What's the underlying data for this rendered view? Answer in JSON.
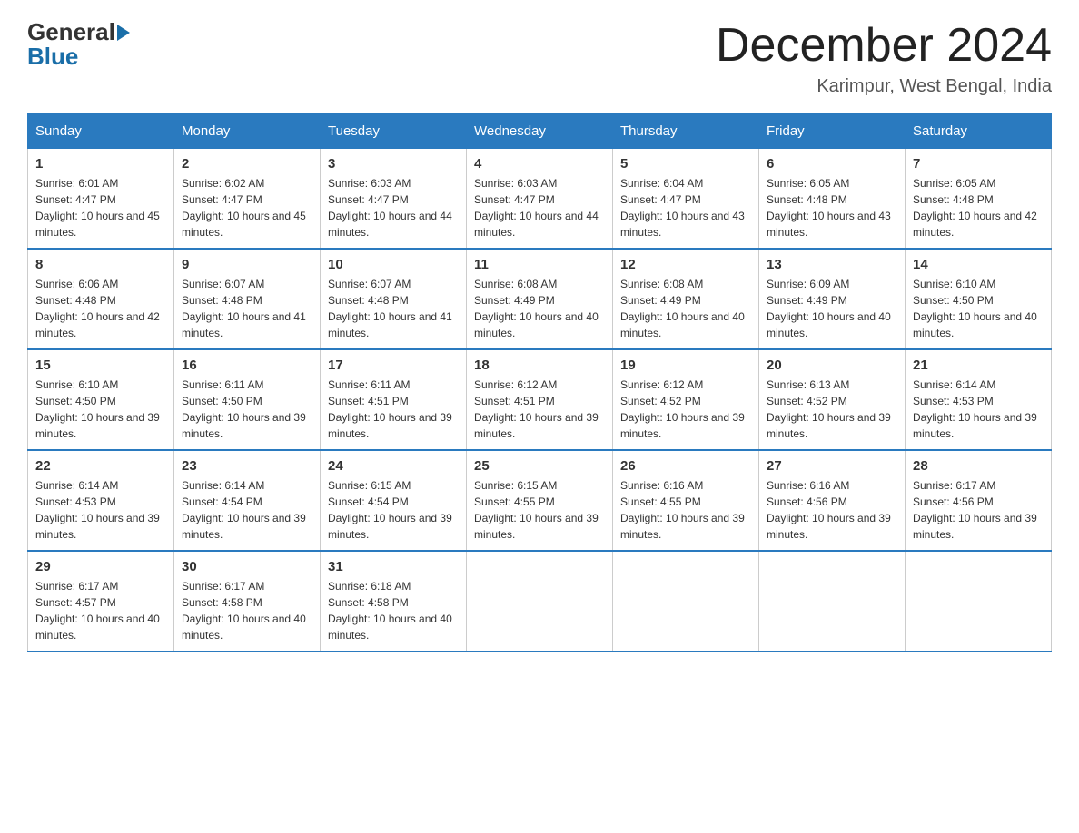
{
  "header": {
    "logo_general": "General",
    "logo_blue": "Blue",
    "month_title": "December 2024",
    "location": "Karimpur, West Bengal, India"
  },
  "weekdays": [
    "Sunday",
    "Monday",
    "Tuesday",
    "Wednesday",
    "Thursday",
    "Friday",
    "Saturday"
  ],
  "weeks": [
    [
      {
        "day": "1",
        "sunrise": "6:01 AM",
        "sunset": "4:47 PM",
        "daylight": "10 hours and 45 minutes."
      },
      {
        "day": "2",
        "sunrise": "6:02 AM",
        "sunset": "4:47 PM",
        "daylight": "10 hours and 45 minutes."
      },
      {
        "day": "3",
        "sunrise": "6:03 AM",
        "sunset": "4:47 PM",
        "daylight": "10 hours and 44 minutes."
      },
      {
        "day": "4",
        "sunrise": "6:03 AM",
        "sunset": "4:47 PM",
        "daylight": "10 hours and 44 minutes."
      },
      {
        "day": "5",
        "sunrise": "6:04 AM",
        "sunset": "4:47 PM",
        "daylight": "10 hours and 43 minutes."
      },
      {
        "day": "6",
        "sunrise": "6:05 AM",
        "sunset": "4:48 PM",
        "daylight": "10 hours and 43 minutes."
      },
      {
        "day": "7",
        "sunrise": "6:05 AM",
        "sunset": "4:48 PM",
        "daylight": "10 hours and 42 minutes."
      }
    ],
    [
      {
        "day": "8",
        "sunrise": "6:06 AM",
        "sunset": "4:48 PM",
        "daylight": "10 hours and 42 minutes."
      },
      {
        "day": "9",
        "sunrise": "6:07 AM",
        "sunset": "4:48 PM",
        "daylight": "10 hours and 41 minutes."
      },
      {
        "day": "10",
        "sunrise": "6:07 AM",
        "sunset": "4:48 PM",
        "daylight": "10 hours and 41 minutes."
      },
      {
        "day": "11",
        "sunrise": "6:08 AM",
        "sunset": "4:49 PM",
        "daylight": "10 hours and 40 minutes."
      },
      {
        "day": "12",
        "sunrise": "6:08 AM",
        "sunset": "4:49 PM",
        "daylight": "10 hours and 40 minutes."
      },
      {
        "day": "13",
        "sunrise": "6:09 AM",
        "sunset": "4:49 PM",
        "daylight": "10 hours and 40 minutes."
      },
      {
        "day": "14",
        "sunrise": "6:10 AM",
        "sunset": "4:50 PM",
        "daylight": "10 hours and 40 minutes."
      }
    ],
    [
      {
        "day": "15",
        "sunrise": "6:10 AM",
        "sunset": "4:50 PM",
        "daylight": "10 hours and 39 minutes."
      },
      {
        "day": "16",
        "sunrise": "6:11 AM",
        "sunset": "4:50 PM",
        "daylight": "10 hours and 39 minutes."
      },
      {
        "day": "17",
        "sunrise": "6:11 AM",
        "sunset": "4:51 PM",
        "daylight": "10 hours and 39 minutes."
      },
      {
        "day": "18",
        "sunrise": "6:12 AM",
        "sunset": "4:51 PM",
        "daylight": "10 hours and 39 minutes."
      },
      {
        "day": "19",
        "sunrise": "6:12 AM",
        "sunset": "4:52 PM",
        "daylight": "10 hours and 39 minutes."
      },
      {
        "day": "20",
        "sunrise": "6:13 AM",
        "sunset": "4:52 PM",
        "daylight": "10 hours and 39 minutes."
      },
      {
        "day": "21",
        "sunrise": "6:14 AM",
        "sunset": "4:53 PM",
        "daylight": "10 hours and 39 minutes."
      }
    ],
    [
      {
        "day": "22",
        "sunrise": "6:14 AM",
        "sunset": "4:53 PM",
        "daylight": "10 hours and 39 minutes."
      },
      {
        "day": "23",
        "sunrise": "6:14 AM",
        "sunset": "4:54 PM",
        "daylight": "10 hours and 39 minutes."
      },
      {
        "day": "24",
        "sunrise": "6:15 AM",
        "sunset": "4:54 PM",
        "daylight": "10 hours and 39 minutes."
      },
      {
        "day": "25",
        "sunrise": "6:15 AM",
        "sunset": "4:55 PM",
        "daylight": "10 hours and 39 minutes."
      },
      {
        "day": "26",
        "sunrise": "6:16 AM",
        "sunset": "4:55 PM",
        "daylight": "10 hours and 39 minutes."
      },
      {
        "day": "27",
        "sunrise": "6:16 AM",
        "sunset": "4:56 PM",
        "daylight": "10 hours and 39 minutes."
      },
      {
        "day": "28",
        "sunrise": "6:17 AM",
        "sunset": "4:56 PM",
        "daylight": "10 hours and 39 minutes."
      }
    ],
    [
      {
        "day": "29",
        "sunrise": "6:17 AM",
        "sunset": "4:57 PM",
        "daylight": "10 hours and 40 minutes."
      },
      {
        "day": "30",
        "sunrise": "6:17 AM",
        "sunset": "4:58 PM",
        "daylight": "10 hours and 40 minutes."
      },
      {
        "day": "31",
        "sunrise": "6:18 AM",
        "sunset": "4:58 PM",
        "daylight": "10 hours and 40 minutes."
      },
      null,
      null,
      null,
      null
    ]
  ],
  "labels": {
    "sunrise": "Sunrise:",
    "sunset": "Sunset:",
    "daylight": "Daylight:"
  }
}
